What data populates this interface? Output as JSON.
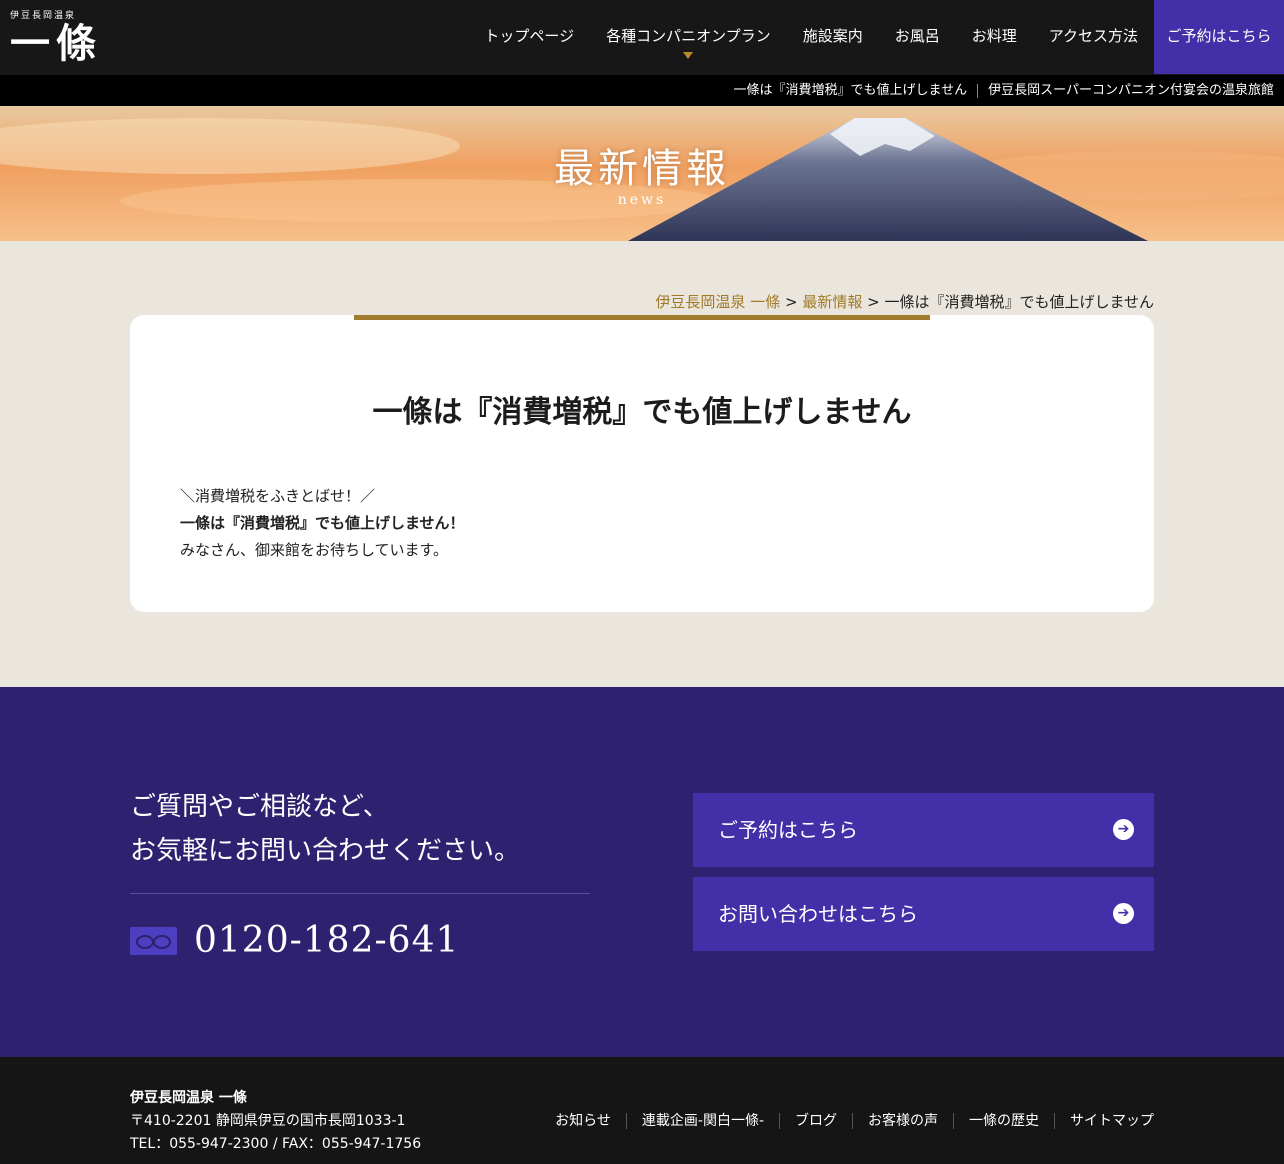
{
  "header": {
    "logo_sub": "伊豆長岡温泉",
    "logo_main": "一條",
    "nav": [
      "トップページ",
      "各種コンパニオンプラン",
      "施設案内",
      "お風呂",
      "お料理",
      "アクセス方法"
    ],
    "reserve": "ご予約はこちら"
  },
  "subbar": {
    "left": "一條は『消費増税』でも値上げしません",
    "right": "伊豆長岡スーパーコンパニオン付宴会の温泉旅館"
  },
  "hero": {
    "title": "最新情報",
    "subtitle": "news"
  },
  "breadcrumb": {
    "home": "伊豆長岡温泉 一條",
    "sep1": " > ",
    "section": "最新情報",
    "sep2": " > ",
    "current": "一條は『消費増税』でも値上げしません"
  },
  "article": {
    "title": "一條は『消費増税』でも値上げしません",
    "line1": "＼消費増税をふきとばせ！／",
    "line2": "一條は『消費増税』でも値上げしません！",
    "line3": "みなさん、御来館をお待ちしています。"
  },
  "contact": {
    "text1": "ご質問やご相談など、",
    "text2": "お気軽にお問い合わせください。",
    "phone": "0120-182-641",
    "btn_reserve": "ご予約はこちら",
    "btn_inquiry": "お問い合わせはこちら",
    "arrow": "➔"
  },
  "footer": {
    "name": "伊豆長岡温泉 一條",
    "address": "〒410-2201 静岡県伊豆の国市長岡1033-1",
    "tel": "TEL：055-947-2300 / FAX：055-947-1756",
    "links": [
      "お知らせ",
      "連載企画-関白一條-",
      "ブログ",
      "お客様の声",
      "一條の歴史",
      "サイトマップ"
    ]
  }
}
